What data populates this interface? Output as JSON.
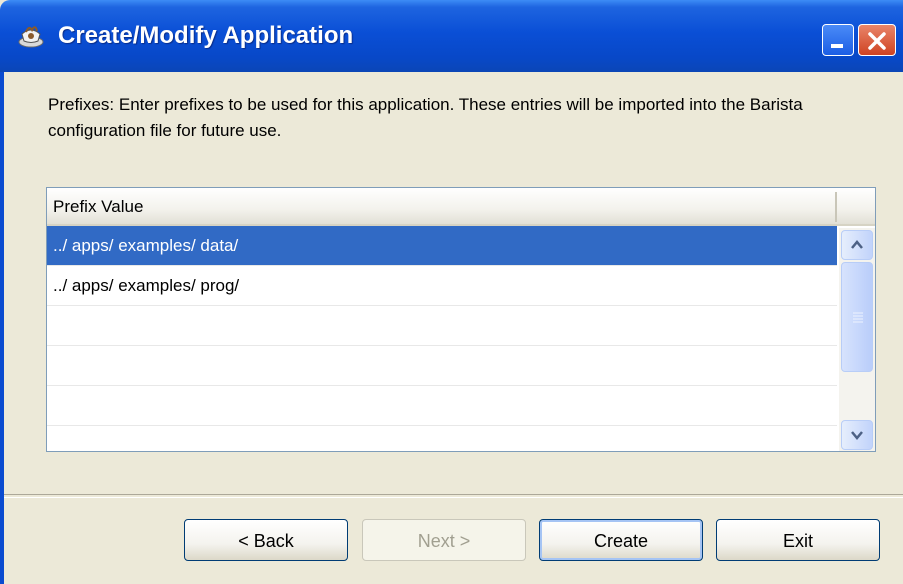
{
  "window": {
    "title": "Create/Modify Application",
    "icons": {
      "app": "barista-app-icon",
      "minimize": "minimize-icon",
      "close": "close-icon"
    },
    "colors": {
      "titlebar": "#0a4fd6",
      "selection": "#316ac5",
      "face": "#ece9d8"
    }
  },
  "description": "Prefixes: Enter prefixes to be used for this application.  These entries will be imported into the Barista configuration file for future use.",
  "prefix_list": {
    "column_header": "Prefix Value",
    "rows": [
      {
        "value": "../ apps/ examples/ data/",
        "selected": true
      },
      {
        "value": "../ apps/ examples/ prog/",
        "selected": false
      },
      {
        "value": "",
        "selected": false
      },
      {
        "value": "",
        "selected": false
      },
      {
        "value": "",
        "selected": false
      }
    ]
  },
  "buttons": {
    "back": "< Back",
    "next": "Next >",
    "create": "Create",
    "exit": "Exit"
  }
}
